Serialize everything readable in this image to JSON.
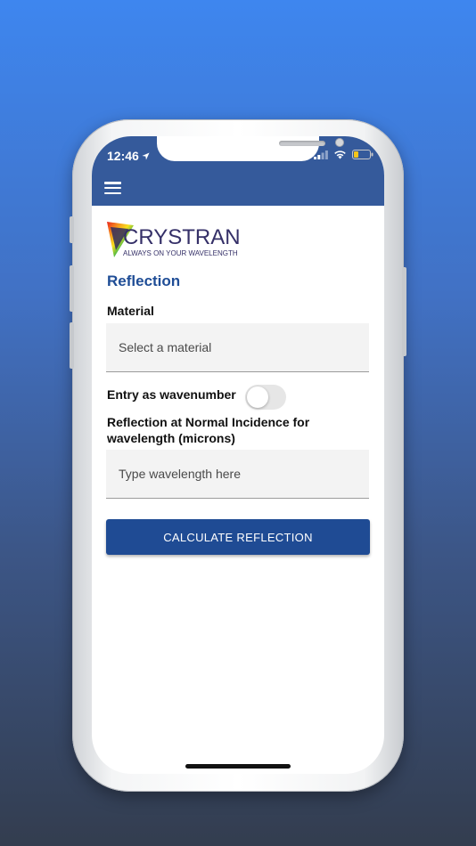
{
  "status_bar": {
    "time": "12:46"
  },
  "app": {
    "logo_name": "CRYSTRAN",
    "logo_tagline": "ALWAYS ON YOUR WAVELENGTH",
    "section_title": "Reflection"
  },
  "form": {
    "material_label": "Material",
    "material_placeholder": "Select a material",
    "wavenumber_label": "Entry as wavenumber",
    "wavenumber_enabled": false,
    "wavelength_label_line1": "Reflection at Normal Incidence for",
    "wavelength_label_line2": "wavelength (microns)",
    "wavelength_placeholder": "Type wavelength here",
    "calculate_label": "CALCULATE REFLECTION"
  },
  "colors": {
    "app_bar": "#355a9b",
    "primary_button": "#1f4b94",
    "section_title": "#1f4d96"
  }
}
